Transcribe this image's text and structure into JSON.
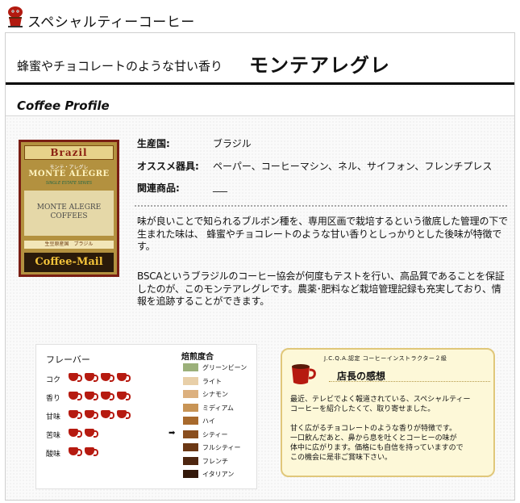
{
  "header": {
    "site_title": "スペシャルティーコーヒー",
    "logo_icon": "coffee-mascot-icon"
  },
  "title": {
    "subtitle": "蜂蜜やチョコレートのような甘い香り",
    "product_name": "モンテアレグレ"
  },
  "profile": {
    "heading": "Coffee Profile"
  },
  "package": {
    "top": "Brazil",
    "kana": "モンテ・アレグレ",
    "name": "MONTE ALEGRE",
    "series": "SINGLE ESTATE SERIES",
    "band_text_1": "MONTE ALEGRE",
    "band_text_2": "COFFEES",
    "strip": "生豆原産国　ブラジル",
    "logo": "Coffee-Mail"
  },
  "info": {
    "origin_label": "生産国:",
    "origin_value": "ブラジル",
    "equipment_label": "オススメ器具:",
    "equipment_value": "ペーパー、コーヒーマシン、ネル、サイフォン、フレンチプレス",
    "related_label": "関連商品:",
    "related_value": "___"
  },
  "description": {
    "para1": "味が良いことで知られるブルボン種を、専用区画で栽培するという徹底した管理の下で生まれた味は、 蜂蜜やチョコレートのような甘い香りとしっかりとした後味が特徴です。",
    "para2": "BSCAというブラジルのコーヒー協会が何度もテストを行い、高品質であることを保証したのが、このモンテアレグレです。農薬･肥料など栽培管理記録も充実しており、情報を追跡することができます。"
  },
  "flavor": {
    "title": "フレーバー",
    "rows": [
      {
        "label": "コク",
        "cups": 4
      },
      {
        "label": "香り",
        "cups": 4
      },
      {
        "label": "甘味",
        "cups": 4
      },
      {
        "label": "苦味",
        "cups": 2
      },
      {
        "label": "酸味",
        "cups": 2
      }
    ]
  },
  "roast": {
    "title": "焙煎度合",
    "selected": "シティー",
    "items": [
      {
        "label": "グリーンビーン",
        "color": "#9bb07a"
      },
      {
        "label": "ライト",
        "color": "#e8cfa8"
      },
      {
        "label": "シナモン",
        "color": "#dcb07e"
      },
      {
        "label": "ミディアム",
        "color": "#c89455"
      },
      {
        "label": "ハイ",
        "color": "#a86a2c"
      },
      {
        "label": "シティー",
        "color": "#8a4e1e"
      },
      {
        "label": "フルシティー",
        "color": "#6b3714"
      },
      {
        "label": "フレンチ",
        "color": "#4e2610"
      },
      {
        "label": "イタリアン",
        "color": "#33180a"
      }
    ]
  },
  "manager": {
    "cert": "J.C.Q.A.認定 コーヒーインストラクター２級",
    "title": "店長の感想",
    "p1_l1": "最近、テレビでよく報道されている、スペシャルティー",
    "p1_l2": "コーヒーを紹介したくて、取り寄せました。",
    "p2_l1": "甘く広がるチョコレートのような香りが特徴です。",
    "p2_l2": "一口飲んだあと、鼻から息を吐くとコーヒーの味が",
    "p2_l3": "体中に広がります。価格にも自信を持っていますので",
    "p2_l4": "この機会に是非ご賞味下さい。"
  }
}
